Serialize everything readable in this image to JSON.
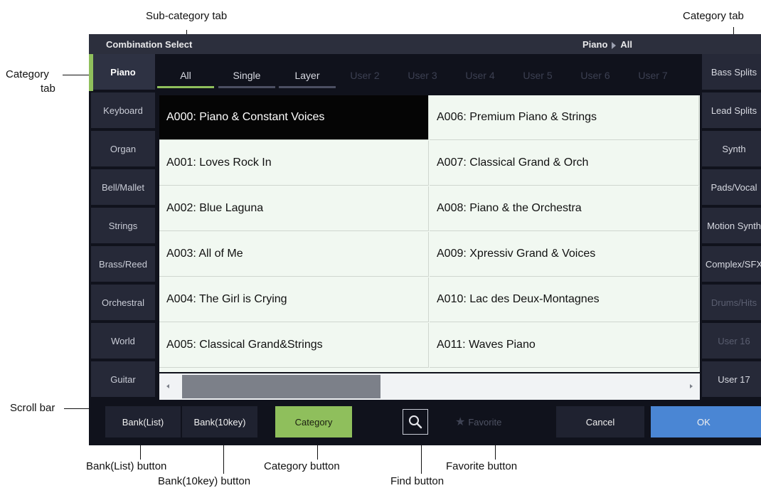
{
  "callouts": {
    "subcategory_tab": "Sub-category tab",
    "category_tab_right": "Category tab",
    "category_tab_left_1": "Category",
    "category_tab_left_2": "tab",
    "scroll_bar": "Scroll bar",
    "bank_list_button": "Bank(List) button",
    "bank_10key_button": "Bank(10key) button",
    "category_button": "Category button",
    "find_button": "Find button",
    "favorite_button": "Favorite button"
  },
  "screen": {
    "title": "Combination Select",
    "breadcrumb_category": "Piano",
    "breadcrumb_sub": "All"
  },
  "left_tabs": [
    "Piano",
    "Keyboard",
    "Organ",
    "Bell/Mallet",
    "Strings",
    "Brass/Reed",
    "Orchestral",
    "World",
    "Guitar"
  ],
  "right_tabs": [
    "Bass Splits",
    "Lead Splits",
    "Synth",
    "Pads/Vocal",
    "Motion Synth",
    "Complex/SFX",
    "Drums/Hits",
    "User 16",
    "User 17"
  ],
  "sub_tabs": [
    "All",
    "Single",
    "Layer",
    "User 2",
    "User 3",
    "User 4",
    "User 5",
    "User 6",
    "User 7"
  ],
  "programs": [
    "A000: Piano & Constant Voices",
    "A001: Loves Rock In",
    "A002: Blue Laguna",
    "A003: All of Me",
    "A004: The Girl is Crying",
    "A005: Classical Grand&Strings",
    "A006: Premium Piano & Strings",
    "A007: Classical Grand & Orch",
    "A008: Piano & the Orchestra",
    "A009: Xpressiv Grand & Voices",
    "A010: Lac des Deux-Montagnes",
    "A011: Waves Piano"
  ],
  "buttons": {
    "bank_list": "Bank(List)",
    "bank_10key": "Bank(10key)",
    "category": "Category",
    "favorite": "Favorite",
    "cancel": "Cancel",
    "ok": "OK"
  },
  "colors": {
    "accent_green": "#8fbf5c",
    "ok_blue": "#4a86d4",
    "selected_row": "#050505",
    "list_bg": "#f1f8f1"
  },
  "icons": {
    "find": "magnifier-icon",
    "favorite": "star-icon"
  }
}
